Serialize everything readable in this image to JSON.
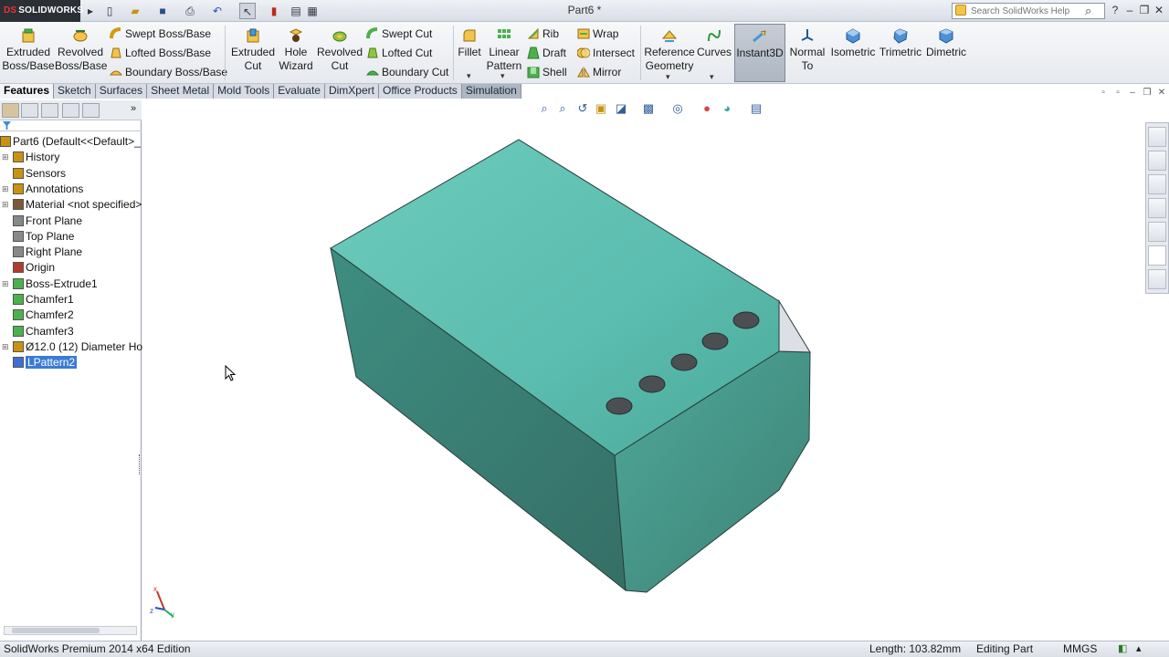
{
  "app": {
    "logo_text": "SOLIDWORKS",
    "document_title": "Part6 *",
    "help_search_placeholder": "Search SolidWorks Help"
  },
  "commands": {
    "extruded_boss": "Extruded Boss/Base",
    "revolved_boss": "Revolved Boss/Base",
    "swept_boss": "Swept Boss/Base",
    "lofted_boss": "Lofted Boss/Base",
    "boundary_boss": "Boundary Boss/Base",
    "extruded_cut": "Extruded Cut",
    "hole_wizard": "Hole Wizard",
    "revolved_cut": "Revolved Cut",
    "swept_cut": "Swept Cut",
    "lofted_cut": "Lofted Cut",
    "boundary_cut": "Boundary Cut",
    "fillet": "Fillet",
    "linear_pattern": "Linear Pattern",
    "rib": "Rib",
    "draft": "Draft",
    "shell": "Shell",
    "wrap": "Wrap",
    "intersect": "Intersect",
    "mirror": "Mirror",
    "reference_geometry": "Reference Geometry",
    "curves": "Curves",
    "instant3d": "Instant3D",
    "normal_to": "Normal To",
    "isometric": "Isometric",
    "trimetric": "Trimetric",
    "dimetric": "Dimetric"
  },
  "tabs": [
    "Features",
    "Sketch",
    "Surfaces",
    "Sheet Metal",
    "Mold Tools",
    "Evaluate",
    "DimXpert",
    "Office Products",
    "Simulation"
  ],
  "tree": {
    "root": "Part6  (Default<<Default>_",
    "items": [
      "History",
      "Sensors",
      "Annotations",
      "Material <not specified>",
      "Front Plane",
      "Top Plane",
      "Right Plane",
      "Origin",
      "Boss-Extrude1",
      "Chamfer1",
      "Chamfer2",
      "Chamfer3",
      "Ø12.0 (12) Diameter Hole1"
    ],
    "selected": "LPattern2"
  },
  "status": {
    "edition": "SolidWorks Premium 2014 x64 Edition",
    "length": "Length: 103.82mm",
    "mode": "Editing Part",
    "units": "MMGS"
  },
  "triad": {
    "x": "x",
    "y": "y",
    "z": "z"
  },
  "colors": {
    "model_top": "#5fbfb2",
    "model_left": "#3f8c80",
    "model_front": "#4a9d90",
    "selection": "#3a7bd5"
  }
}
